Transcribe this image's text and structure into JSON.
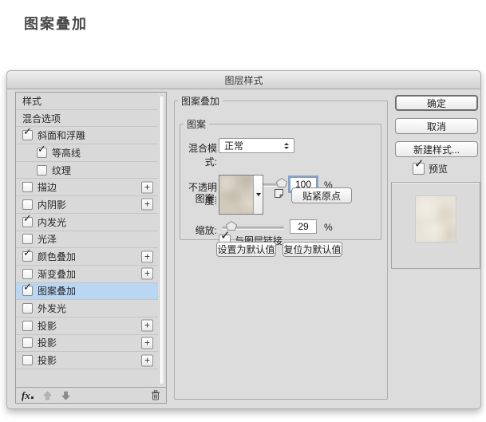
{
  "colors": {
    "selected_row": "#b9d7f2",
    "focus_ring": "#7aa7d9",
    "pattern_base": "#cfc8ba",
    "preview_base": "#e8e3d7"
  },
  "page_title": "图案叠加",
  "dialog": {
    "title": "图层样式",
    "sidebar": {
      "items": [
        {
          "label": "样式",
          "checkbox": false,
          "checked": false,
          "indent": false,
          "plus": false,
          "selected": false
        },
        {
          "label": "混合选项",
          "checkbox": false,
          "checked": false,
          "indent": false,
          "plus": false,
          "selected": false
        },
        {
          "label": "斜面和浮雕",
          "checkbox": true,
          "checked": true,
          "indent": false,
          "plus": false,
          "selected": false
        },
        {
          "label": "等高线",
          "checkbox": true,
          "checked": true,
          "indent": true,
          "plus": false,
          "selected": false
        },
        {
          "label": "纹理",
          "checkbox": true,
          "checked": false,
          "indent": true,
          "plus": false,
          "selected": false
        },
        {
          "label": "描边",
          "checkbox": true,
          "checked": false,
          "indent": false,
          "plus": true,
          "selected": false
        },
        {
          "label": "内阴影",
          "checkbox": true,
          "checked": false,
          "indent": false,
          "plus": true,
          "selected": false
        },
        {
          "label": "内发光",
          "checkbox": true,
          "checked": true,
          "indent": false,
          "plus": false,
          "selected": false
        },
        {
          "label": "光泽",
          "checkbox": true,
          "checked": false,
          "indent": false,
          "plus": false,
          "selected": false
        },
        {
          "label": "颜色叠加",
          "checkbox": true,
          "checked": true,
          "indent": false,
          "plus": true,
          "selected": false
        },
        {
          "label": "渐变叠加",
          "checkbox": true,
          "checked": false,
          "indent": false,
          "plus": true,
          "selected": false
        },
        {
          "label": "图案叠加",
          "checkbox": true,
          "checked": true,
          "indent": false,
          "plus": false,
          "selected": true
        },
        {
          "label": "外发光",
          "checkbox": true,
          "checked": false,
          "indent": false,
          "plus": false,
          "selected": false
        },
        {
          "label": "投影",
          "checkbox": true,
          "checked": false,
          "indent": false,
          "plus": true,
          "selected": false
        },
        {
          "label": "投影",
          "checkbox": true,
          "checked": false,
          "indent": false,
          "plus": true,
          "selected": false
        },
        {
          "label": "投影",
          "checkbox": true,
          "checked": false,
          "indent": false,
          "plus": true,
          "selected": false
        }
      ],
      "footer": {
        "fx_label": "fx",
        "plus_label": "+"
      }
    },
    "panel": {
      "header": "图案叠加",
      "group_label": "图案",
      "blend_mode_label": "混合模式:",
      "blend_mode_value": "正常",
      "opacity_label": "不透明度:",
      "opacity_value": "100",
      "opacity_unit": "%",
      "pattern_label": "图案:",
      "snap_origin_button": "贴紧原点",
      "scale_label": "缩放:",
      "scale_value": "29",
      "scale_unit": "%",
      "link_layer_label": "与图层链接",
      "make_default_button": "设置为默认值",
      "reset_default_button": "复位为默认值"
    },
    "actions": {
      "ok": "确定",
      "cancel": "取消",
      "new_style": "新建样式...",
      "preview_label": "预览"
    }
  }
}
